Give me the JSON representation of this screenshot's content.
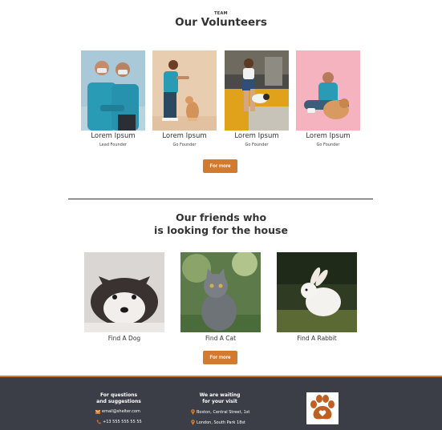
{
  "team": {
    "eyebrow": "TEAM",
    "title": "Our Volunteers",
    "members": [
      {
        "name": "Lorem Ipsum",
        "role": "Lead Founder"
      },
      {
        "name": "Lorem Ipsum",
        "role": "Go Founder"
      },
      {
        "name": "Lorem Ipsum",
        "role": "Go Founder"
      },
      {
        "name": "Lorem Ipsum",
        "role": "Go Founder"
      }
    ],
    "more_label": "For more"
  },
  "friends": {
    "title_line1": "Our friends who",
    "title_line2": "is looking for the house",
    "pets": [
      {
        "label": "Find A Dog"
      },
      {
        "label": "Find A Cat"
      },
      {
        "label": "Find A Rabbit"
      }
    ],
    "more_label": "For more"
  },
  "footer": {
    "questions_line1": "For questions",
    "questions_line2": "and suggestions",
    "email": "email@shelter.com",
    "phone": "+13 555 555 55 55",
    "visit_line1": "We are waiting",
    "visit_line2": "for your visit",
    "address1": "Boston, Central Street, 1st",
    "address2": "London, South Park 18st"
  },
  "colors": {
    "accent": "#d37a2e",
    "footer_bg": "#3b3e46"
  }
}
